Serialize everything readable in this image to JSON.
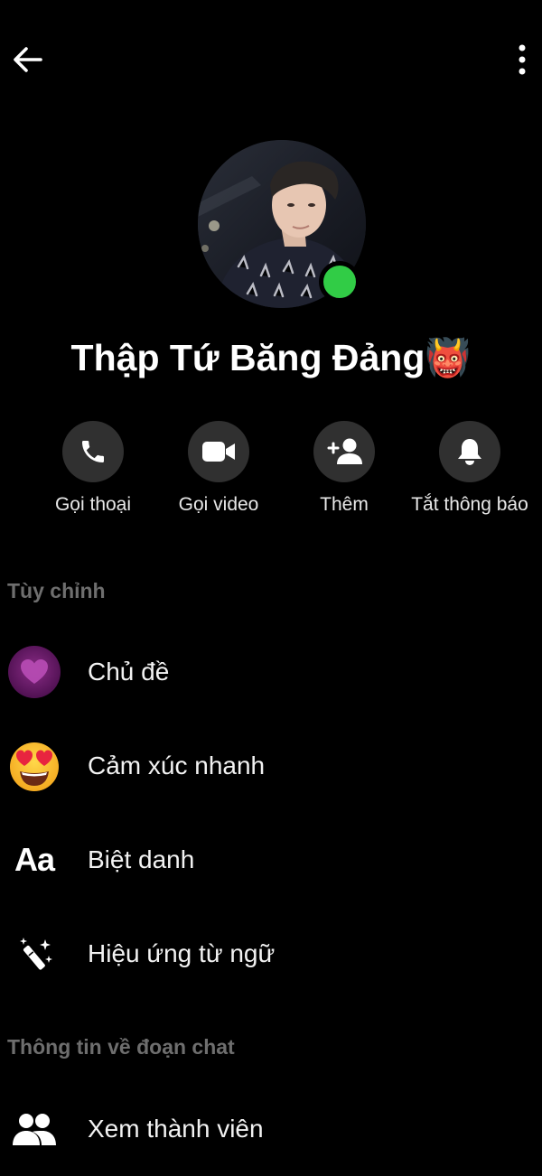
{
  "header": {
    "back_icon": "arrow-left-icon",
    "more_icon": "more-vertical-icon"
  },
  "profile": {
    "name": "Thập Tứ Băng Đảng👹",
    "online": true,
    "status_color": "#31cc46"
  },
  "actions": [
    {
      "label": "Gọi thoại",
      "icon": "phone-icon"
    },
    {
      "label": "Gọi video",
      "icon": "video-camera-icon"
    },
    {
      "label": "Thêm",
      "icon": "add-person-icon"
    },
    {
      "label": "Tắt thông báo",
      "icon": "bell-icon"
    }
  ],
  "sections": {
    "customize": {
      "title": "Tùy chỉnh",
      "items": [
        {
          "label": "Chủ đề",
          "icon": "theme-heart-icon"
        },
        {
          "label": "Cảm xúc nhanh",
          "icon": "heart-eyes-emoji-icon"
        },
        {
          "label": "Biệt danh",
          "icon": "aa-text-icon",
          "glyph": "Aa"
        },
        {
          "label": "Hiệu ứng từ ngữ",
          "icon": "magic-wand-icon"
        }
      ]
    },
    "chat_info": {
      "title": "Thông tin về đoạn chat",
      "items": [
        {
          "label": "Xem thành viên",
          "icon": "people-icon"
        }
      ]
    }
  },
  "colors": {
    "background": "#000000",
    "action_circle": "#303030",
    "section_title": "#6e6e6e",
    "online": "#31cc46",
    "theme_purple": "#6b1f6e"
  }
}
